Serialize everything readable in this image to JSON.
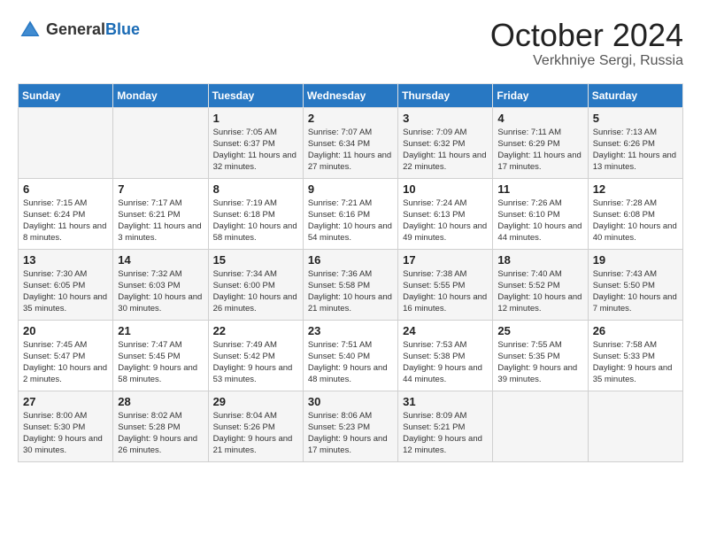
{
  "header": {
    "logo": {
      "general": "General",
      "blue": "Blue"
    },
    "month": "October 2024",
    "location": "Verkhniye Sergi, Russia"
  },
  "days_of_week": [
    "Sunday",
    "Monday",
    "Tuesday",
    "Wednesday",
    "Thursday",
    "Friday",
    "Saturday"
  ],
  "weeks": [
    [
      {
        "day": "",
        "sunrise": "",
        "sunset": "",
        "daylight": ""
      },
      {
        "day": "",
        "sunrise": "",
        "sunset": "",
        "daylight": ""
      },
      {
        "day": "1",
        "sunrise": "Sunrise: 7:05 AM",
        "sunset": "Sunset: 6:37 PM",
        "daylight": "Daylight: 11 hours and 32 minutes."
      },
      {
        "day": "2",
        "sunrise": "Sunrise: 7:07 AM",
        "sunset": "Sunset: 6:34 PM",
        "daylight": "Daylight: 11 hours and 27 minutes."
      },
      {
        "day": "3",
        "sunrise": "Sunrise: 7:09 AM",
        "sunset": "Sunset: 6:32 PM",
        "daylight": "Daylight: 11 hours and 22 minutes."
      },
      {
        "day": "4",
        "sunrise": "Sunrise: 7:11 AM",
        "sunset": "Sunset: 6:29 PM",
        "daylight": "Daylight: 11 hours and 17 minutes."
      },
      {
        "day": "5",
        "sunrise": "Sunrise: 7:13 AM",
        "sunset": "Sunset: 6:26 PM",
        "daylight": "Daylight: 11 hours and 13 minutes."
      }
    ],
    [
      {
        "day": "6",
        "sunrise": "Sunrise: 7:15 AM",
        "sunset": "Sunset: 6:24 PM",
        "daylight": "Daylight: 11 hours and 8 minutes."
      },
      {
        "day": "7",
        "sunrise": "Sunrise: 7:17 AM",
        "sunset": "Sunset: 6:21 PM",
        "daylight": "Daylight: 11 hours and 3 minutes."
      },
      {
        "day": "8",
        "sunrise": "Sunrise: 7:19 AM",
        "sunset": "Sunset: 6:18 PM",
        "daylight": "Daylight: 10 hours and 58 minutes."
      },
      {
        "day": "9",
        "sunrise": "Sunrise: 7:21 AM",
        "sunset": "Sunset: 6:16 PM",
        "daylight": "Daylight: 10 hours and 54 minutes."
      },
      {
        "day": "10",
        "sunrise": "Sunrise: 7:24 AM",
        "sunset": "Sunset: 6:13 PM",
        "daylight": "Daylight: 10 hours and 49 minutes."
      },
      {
        "day": "11",
        "sunrise": "Sunrise: 7:26 AM",
        "sunset": "Sunset: 6:10 PM",
        "daylight": "Daylight: 10 hours and 44 minutes."
      },
      {
        "day": "12",
        "sunrise": "Sunrise: 7:28 AM",
        "sunset": "Sunset: 6:08 PM",
        "daylight": "Daylight: 10 hours and 40 minutes."
      }
    ],
    [
      {
        "day": "13",
        "sunrise": "Sunrise: 7:30 AM",
        "sunset": "Sunset: 6:05 PM",
        "daylight": "Daylight: 10 hours and 35 minutes."
      },
      {
        "day": "14",
        "sunrise": "Sunrise: 7:32 AM",
        "sunset": "Sunset: 6:03 PM",
        "daylight": "Daylight: 10 hours and 30 minutes."
      },
      {
        "day": "15",
        "sunrise": "Sunrise: 7:34 AM",
        "sunset": "Sunset: 6:00 PM",
        "daylight": "Daylight: 10 hours and 26 minutes."
      },
      {
        "day": "16",
        "sunrise": "Sunrise: 7:36 AM",
        "sunset": "Sunset: 5:58 PM",
        "daylight": "Daylight: 10 hours and 21 minutes."
      },
      {
        "day": "17",
        "sunrise": "Sunrise: 7:38 AM",
        "sunset": "Sunset: 5:55 PM",
        "daylight": "Daylight: 10 hours and 16 minutes."
      },
      {
        "day": "18",
        "sunrise": "Sunrise: 7:40 AM",
        "sunset": "Sunset: 5:52 PM",
        "daylight": "Daylight: 10 hours and 12 minutes."
      },
      {
        "day": "19",
        "sunrise": "Sunrise: 7:43 AM",
        "sunset": "Sunset: 5:50 PM",
        "daylight": "Daylight: 10 hours and 7 minutes."
      }
    ],
    [
      {
        "day": "20",
        "sunrise": "Sunrise: 7:45 AM",
        "sunset": "Sunset: 5:47 PM",
        "daylight": "Daylight: 10 hours and 2 minutes."
      },
      {
        "day": "21",
        "sunrise": "Sunrise: 7:47 AM",
        "sunset": "Sunset: 5:45 PM",
        "daylight": "Daylight: 9 hours and 58 minutes."
      },
      {
        "day": "22",
        "sunrise": "Sunrise: 7:49 AM",
        "sunset": "Sunset: 5:42 PM",
        "daylight": "Daylight: 9 hours and 53 minutes."
      },
      {
        "day": "23",
        "sunrise": "Sunrise: 7:51 AM",
        "sunset": "Sunset: 5:40 PM",
        "daylight": "Daylight: 9 hours and 48 minutes."
      },
      {
        "day": "24",
        "sunrise": "Sunrise: 7:53 AM",
        "sunset": "Sunset: 5:38 PM",
        "daylight": "Daylight: 9 hours and 44 minutes."
      },
      {
        "day": "25",
        "sunrise": "Sunrise: 7:55 AM",
        "sunset": "Sunset: 5:35 PM",
        "daylight": "Daylight: 9 hours and 39 minutes."
      },
      {
        "day": "26",
        "sunrise": "Sunrise: 7:58 AM",
        "sunset": "Sunset: 5:33 PM",
        "daylight": "Daylight: 9 hours and 35 minutes."
      }
    ],
    [
      {
        "day": "27",
        "sunrise": "Sunrise: 8:00 AM",
        "sunset": "Sunset: 5:30 PM",
        "daylight": "Daylight: 9 hours and 30 minutes."
      },
      {
        "day": "28",
        "sunrise": "Sunrise: 8:02 AM",
        "sunset": "Sunset: 5:28 PM",
        "daylight": "Daylight: 9 hours and 26 minutes."
      },
      {
        "day": "29",
        "sunrise": "Sunrise: 8:04 AM",
        "sunset": "Sunset: 5:26 PM",
        "daylight": "Daylight: 9 hours and 21 minutes."
      },
      {
        "day": "30",
        "sunrise": "Sunrise: 8:06 AM",
        "sunset": "Sunset: 5:23 PM",
        "daylight": "Daylight: 9 hours and 17 minutes."
      },
      {
        "day": "31",
        "sunrise": "Sunrise: 8:09 AM",
        "sunset": "Sunset: 5:21 PM",
        "daylight": "Daylight: 9 hours and 12 minutes."
      },
      {
        "day": "",
        "sunrise": "",
        "sunset": "",
        "daylight": ""
      },
      {
        "day": "",
        "sunrise": "",
        "sunset": "",
        "daylight": ""
      }
    ]
  ]
}
